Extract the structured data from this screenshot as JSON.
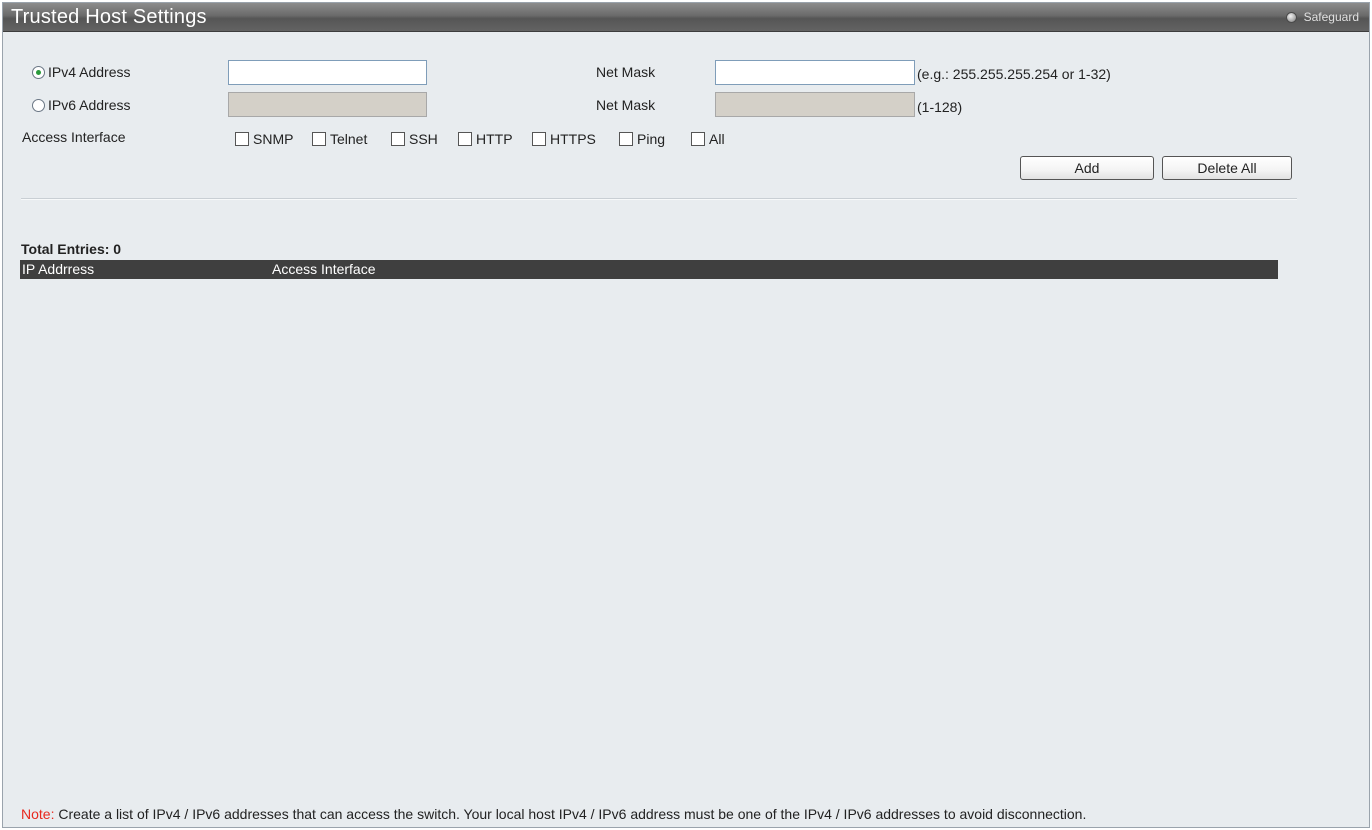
{
  "window": {
    "title": "Trusted Host Settings",
    "safeguard_label": "Safeguard"
  },
  "form": {
    "ipv4": {
      "radio_label": "IPv4 Address",
      "selected": true,
      "value": "",
      "netmask_label": "Net Mask",
      "netmask_value": "",
      "netmask_hint": "(e.g.: 255.255.255.254 or 1-32)"
    },
    "ipv6": {
      "radio_label": "IPv6 Address",
      "selected": false,
      "value": "",
      "netmask_label": "Net Mask",
      "netmask_value": "",
      "netmask_hint": "(1-128)"
    },
    "access_interface": {
      "label": "Access Interface",
      "options": [
        {
          "label": "SNMP",
          "checked": false
        },
        {
          "label": "Telnet",
          "checked": false
        },
        {
          "label": "SSH",
          "checked": false
        },
        {
          "label": "HTTP",
          "checked": false
        },
        {
          "label": "HTTPS",
          "checked": false
        },
        {
          "label": "Ping",
          "checked": false
        },
        {
          "label": "All",
          "checked": false
        }
      ]
    },
    "buttons": {
      "add": "Add",
      "delete_all": "Delete All"
    }
  },
  "table": {
    "total_entries": "Total Entries: 0",
    "columns": [
      "IP Addrress",
      "Access Interface"
    ],
    "rows": []
  },
  "note": {
    "label": "Note:",
    "text": "Create a list of IPv4 / IPv6 addresses that can access the switch. Your local host IPv4 / IPv6 address must be one of the IPv4 / IPv6 addresses to avoid disconnection."
  },
  "colors": {
    "title_bar": "#6a6a6a",
    "panel_background": "#e8ecef",
    "table_header": "#3f3f3f",
    "note_label": "#e8281e",
    "radio_selected": "#2a9a3b"
  }
}
